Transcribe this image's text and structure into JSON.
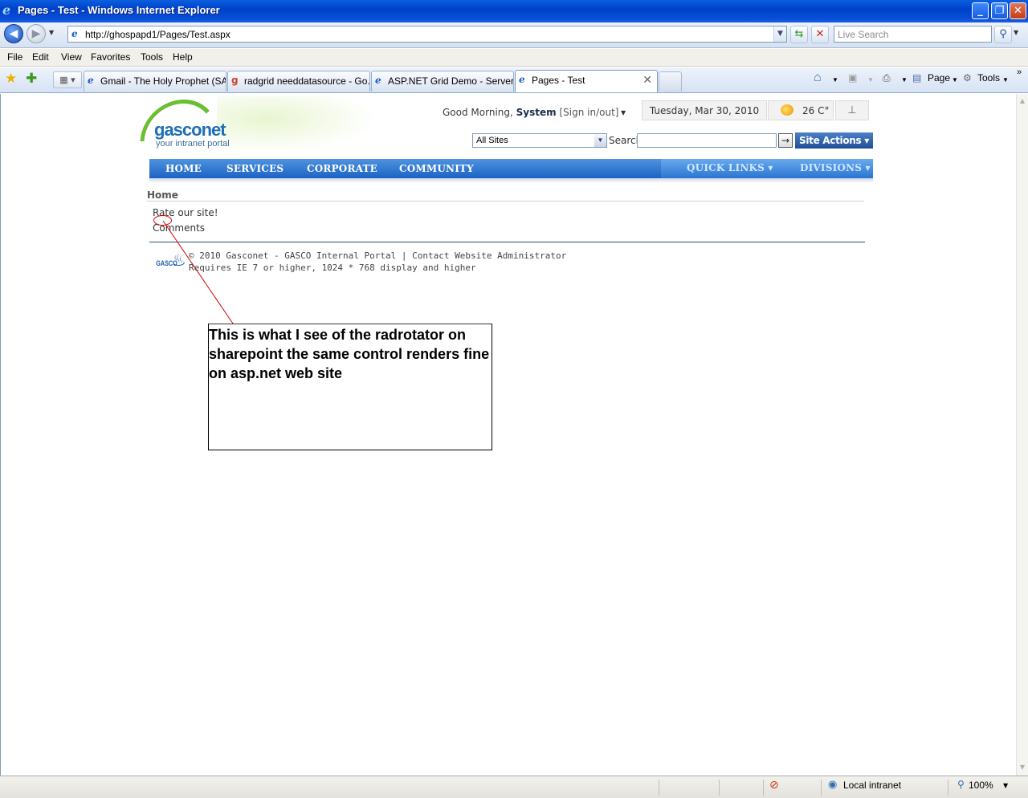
{
  "window": {
    "title": "Pages - Test - Windows Internet Explorer",
    "buttons": {
      "minimize": "_",
      "maximize": "❐",
      "close": "✕"
    }
  },
  "address_bar": {
    "url": "http://ghospapd1/Pages/Test.aspx",
    "search_placeholder": "Live Search"
  },
  "menu": [
    "File",
    "Edit",
    "View",
    "Favorites",
    "Tools",
    "Help"
  ],
  "tabs": [
    {
      "label": "Gmail - The Holy Prophet (SA...",
      "active": false
    },
    {
      "label": "radgrid needdatasource - Go...",
      "active": false
    },
    {
      "label": "ASP.NET Grid Demo - Server-...",
      "active": false
    },
    {
      "label": "Pages - Test",
      "active": true
    }
  ],
  "command_bar": {
    "page": "Page",
    "tools": "Tools"
  },
  "portal": {
    "logo": {
      "name_part1": "gasco",
      "name_part2": "net",
      "tagline": "your intranet portal"
    },
    "greeting": {
      "prefix": "Good Morning,",
      "user": "System",
      "sign": "[Sign in/out]"
    },
    "date": "Tuesday, Mar 30, 2010",
    "temperature": "26 C°",
    "search": {
      "scope": "All Sites",
      "label": "Search",
      "value": "",
      "go": "→"
    },
    "site_actions": "Site Actions ▾",
    "nav": {
      "left": [
        "HOME",
        "SERVICES",
        "CORPORATE",
        "COMMUNITY"
      ],
      "right": [
        "QUICK LINKS ▾",
        "DIVISIONS ▾"
      ]
    },
    "breadcrumb": "Home",
    "content": {
      "rate": "Rate our site!",
      "comments": "Comments"
    },
    "footer": {
      "copyright": "© 2010 Gasconet - GASCO Internal Portal  |  Contact Website Administrator",
      "requirements": "Requires IE 7 or higher, 1024 * 768 display and higher",
      "logo_text": "GASCO"
    }
  },
  "annotation": {
    "text": "This is what I see of the radrotator on sharepoint the same control renders fine on asp.net web site",
    "color": "#cc0000"
  },
  "status_bar": {
    "zone": "Local intranet",
    "zoom": "100%"
  }
}
